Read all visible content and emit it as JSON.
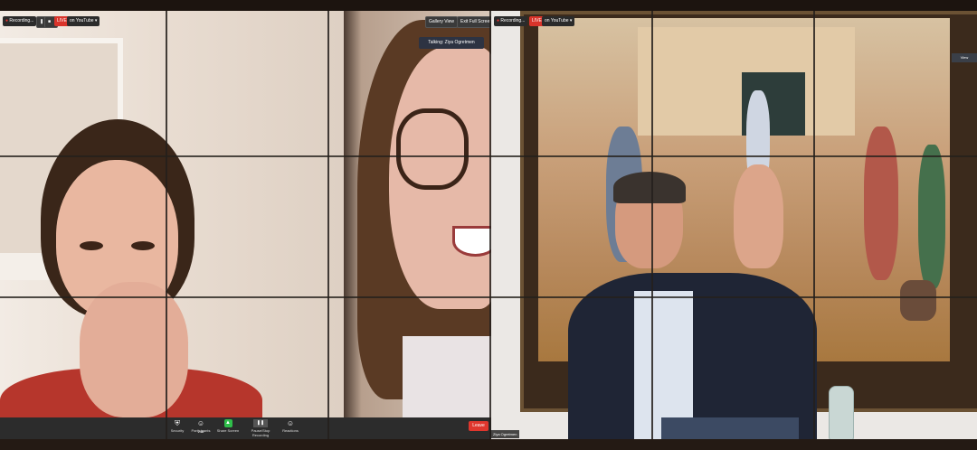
{
  "left_window": {
    "badges": {
      "recording": "Recording...",
      "live": "LIVE",
      "youtube": "on YouTube ▾"
    },
    "view_buttons": {
      "gallery": "Gallery View",
      "exit_fullscreen": "Exit Full Screen"
    },
    "talking": "Talking: Ziya Ogretmen",
    "toolbar": [
      {
        "icon": "shield-icon",
        "glyph": "⛨",
        "label": "Security"
      },
      {
        "icon": "participants-icon",
        "glyph": "☺",
        "label": "Participants",
        "count": "246"
      },
      {
        "icon": "share-screen-icon",
        "glyph": "▲",
        "label": "Share Screen"
      },
      {
        "icon": "pause-recording-icon",
        "glyph": "❚❚",
        "label": "Pause/Stop Recording"
      },
      {
        "icon": "reactions-icon",
        "glyph": "☺",
        "label": "Reactions"
      }
    ],
    "end_button": "Leave"
  },
  "right_window": {
    "badges": {
      "recording": "Recording...",
      "live": "LIVE",
      "youtube": "on YouTube ▾"
    },
    "name_label": "Ziya Ogretmen",
    "side_badge": "View"
  },
  "colors": {
    "live_red": "#d9342b",
    "toolbar_bg": "#2c2c2c",
    "share_green": "#2fbf4a"
  }
}
